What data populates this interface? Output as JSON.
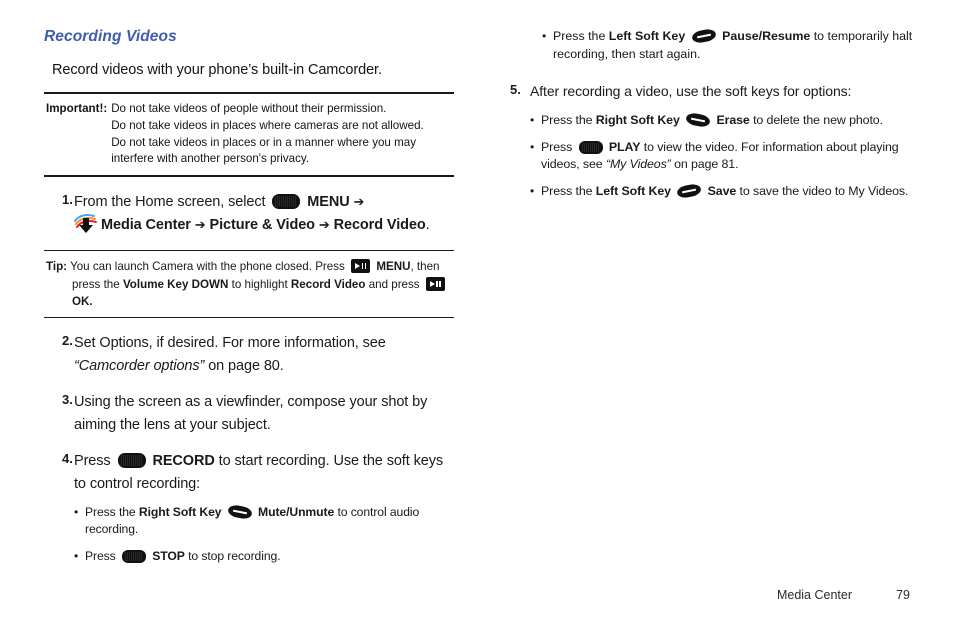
{
  "heading": "Recording Videos",
  "intro": "Record videos with your phone’s built-in Camcorder.",
  "important": {
    "label": "Important!:",
    "lines": [
      "Do not take videos of people without their permission.",
      "Do not take videos in places where cameras are not allowed.",
      "Do not take videos in places or in a manner where you may",
      "interfere with another person's privacy."
    ]
  },
  "tip": {
    "label": "Tip:",
    "text_1": "You can launch Camera with the phone closed. Press",
    "menu_label": "MENU",
    "text_2": ", then press the",
    "volume_key": "Volume Key DOWN",
    "text_3": "to highlight",
    "record_video": "Record Video",
    "text_4": "and press",
    "ok_label": "OK."
  },
  "steps": [
    {
      "num": "1.",
      "text_1": "From the Home screen, select",
      "menu_label": "MENU",
      "arrow": "➔",
      "media_center": "Media Center",
      "picture_video": "Picture & Video",
      "record_video": "Record Video",
      "period": "."
    },
    {
      "num": "2.",
      "text_1": "Set Options, if desired. For more information, see",
      "ref": "“Camcorder options”",
      "text_2": "on page 80."
    },
    {
      "num": "3.",
      "text_1": "Using the screen as a viewfinder, compose your shot by aiming the lens at your subject."
    },
    {
      "num": "4.",
      "text_1": "Press",
      "record_label": "RECORD",
      "text_2": "to start recording. Use the soft keys to control recording:",
      "bullets": [
        {
          "text_1": "Press the",
          "key_label": "Right Soft Key",
          "key_type": "soft-right",
          "action": "Mute/Unmute",
          "text_2": "to control audio recording."
        },
        {
          "text_1": "Press",
          "key_label": "",
          "key_type": "oval",
          "action": "STOP",
          "text_2": "to stop recording."
        }
      ]
    },
    {
      "num": "5.",
      "text_1": "After recording a video, use the soft keys for options:",
      "bullets": [
        {
          "text_1": "Press the",
          "key_label": "Right Soft Key",
          "key_type": "soft-right",
          "action": "Erase",
          "text_2": "to delete the new photo."
        },
        {
          "text_1": "Press",
          "key_label": "",
          "key_type": "oval",
          "action": "PLAY",
          "text_2": "to view the video. For information about playing videos, see",
          "ref": "“My Videos”",
          "text_3": "on page 81."
        },
        {
          "text_1": "Press the",
          "key_label": "Left Soft Key",
          "key_type": "soft-left",
          "action": "Save",
          "text_2": "to save the video to My Videos."
        }
      ]
    }
  ],
  "top_right_bullet": {
    "text_1": "Press the",
    "key_label": "Left Soft Key",
    "action": "Pause/Resume",
    "text_2": "to temporarily halt recording, then start again."
  },
  "footer": {
    "label": "Media Center",
    "page": "79"
  },
  "colors": {
    "heading": "#3f5cae",
    "text": "#1a1a1a",
    "rule": "#1a1a1a"
  }
}
